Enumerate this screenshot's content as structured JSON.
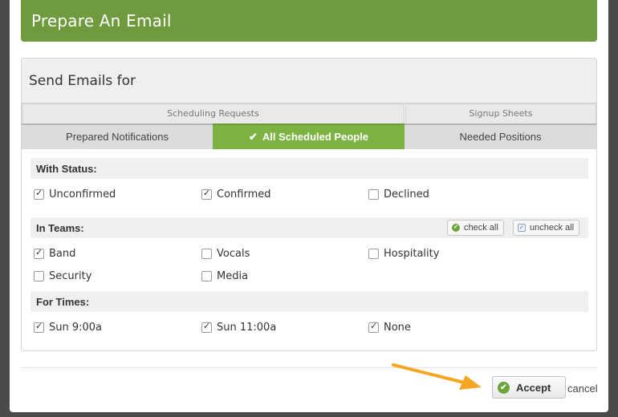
{
  "header": {
    "title": "Prepare An Email"
  },
  "panel": {
    "title": "Send Emails for",
    "tab_groups": [
      "Scheduling Requests",
      "Signup Sheets"
    ],
    "tabs": [
      {
        "label": "Prepared Notifications",
        "active": false
      },
      {
        "label": "All Scheduled People",
        "active": true
      },
      {
        "label": "Needed Positions",
        "active": false
      }
    ]
  },
  "sections": {
    "status": {
      "label": "With Status:",
      "options": [
        {
          "label": "Unconfirmed",
          "checked": true
        },
        {
          "label": "Confirmed",
          "checked": true
        },
        {
          "label": "Declined",
          "checked": false
        }
      ]
    },
    "teams": {
      "label": "In Teams:",
      "check_all": "check all",
      "uncheck_all": "uncheck all",
      "options": [
        {
          "label": "Band",
          "checked": true
        },
        {
          "label": "Vocals",
          "checked": false
        },
        {
          "label": "Hospitality",
          "checked": false
        },
        {
          "label": "Security",
          "checked": false
        },
        {
          "label": "Media",
          "checked": false
        }
      ]
    },
    "times": {
      "label": "For Times:",
      "options": [
        {
          "label": "Sun 9:00a",
          "checked": true
        },
        {
          "label": "Sun 11:00a",
          "checked": true
        },
        {
          "label": "None",
          "checked": true
        }
      ]
    }
  },
  "footer": {
    "accept_label": "Accept",
    "cancel_label": "cancel"
  },
  "colors": {
    "header": "#6f9a3e",
    "active_tab": "#7cb342",
    "annotation_arrow": "#f5a623"
  },
  "icons": {
    "tab_active": "check-icon",
    "accept": "check-circle-icon",
    "check_all": "check-circle-icon",
    "uncheck_all": "checkbox-icon"
  }
}
